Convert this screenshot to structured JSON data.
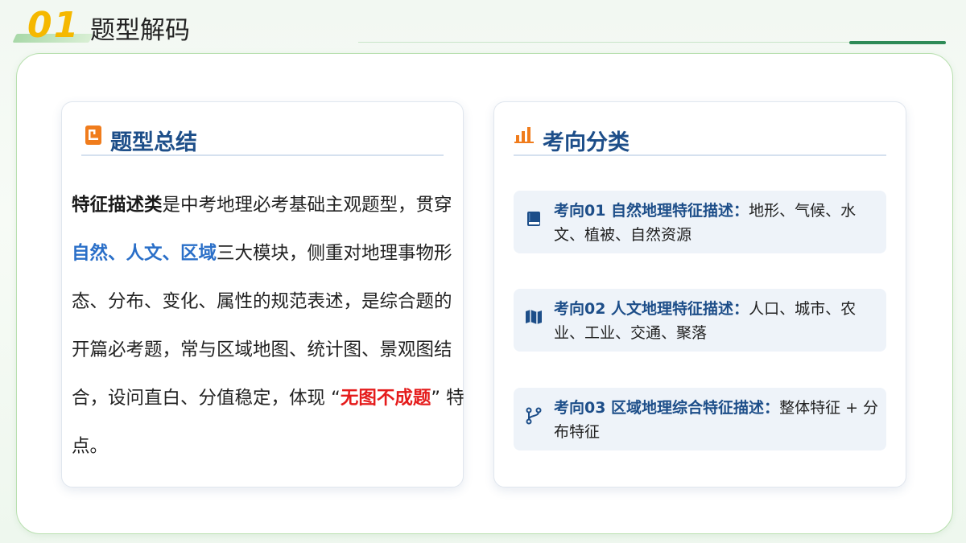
{
  "header": {
    "section_number": "01",
    "title": "题型解码"
  },
  "left_card": {
    "title": "题型总结",
    "icon": "document-icon",
    "paragraph": {
      "highlight_type": "特征描述类",
      "text_1": "是中考地理必考基础主观题型，贯穿",
      "highlight_modules": "自然、人文、区域",
      "text_2": "三大模块，侧重对地理事物形态、分布、变化、属性的规范表述，是综合题的开篇必考题，常与区域地图、统计图、景观图结合，设问直白、分值稳定，体现 “",
      "highlight_feature": "无图不成题",
      "text_3": "” 特点。"
    }
  },
  "right_card": {
    "title": "考向分类",
    "icon": "bar-chart-icon",
    "items": [
      {
        "label": "考向01  自然地理特征描述：",
        "text": "地形、气候、水文、植被、自然资源",
        "icon": "book-icon"
      },
      {
        "label": "考向02  人文地理特征描述：",
        "text": "人口、城市、农业、工业、交通、聚落",
        "icon": "map-icon"
      },
      {
        "label": "考向03  区域地理综合特征描述：",
        "text": "整体特征 + 分布特征",
        "icon": "branch-icon"
      }
    ]
  },
  "colors": {
    "accent_yellow": "#f5b800",
    "title_blue": "#1d4e89",
    "highlight_blue": "#2a6fc8",
    "highlight_red": "#e51c1c",
    "icon_orange": "#f07c1c",
    "panel_border_green": "#b9e0b0"
  }
}
